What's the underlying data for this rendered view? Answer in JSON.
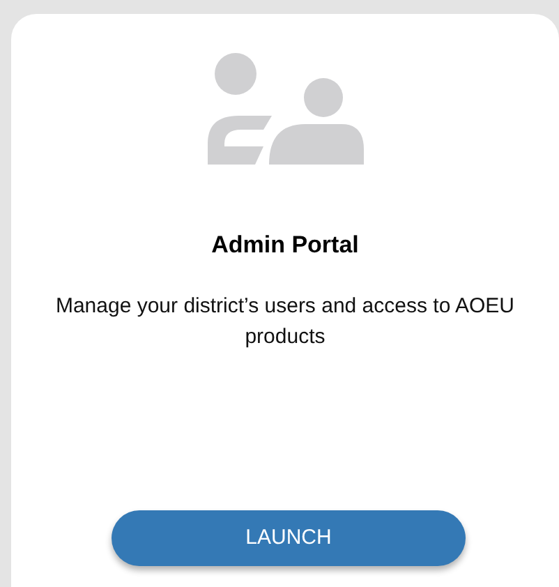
{
  "card": {
    "title": "Admin Portal",
    "description": "Manage your district’s users and access to AOEU products",
    "button": {
      "label": "LAUNCH"
    }
  }
}
